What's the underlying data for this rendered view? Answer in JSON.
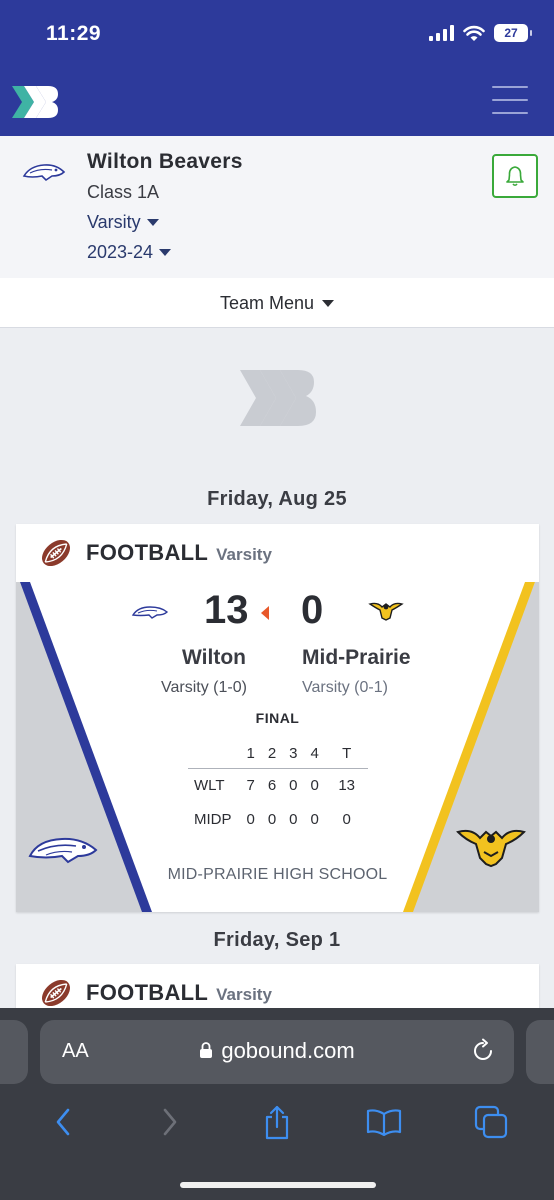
{
  "status_bar": {
    "time": "11:29",
    "battery": "27"
  },
  "team": {
    "name": "Wilton Beavers",
    "class": "Class 1A",
    "level": "Varsity",
    "season": "2023-24",
    "menu_label": "Team Menu"
  },
  "games": [
    {
      "date": "Friday, Aug 25",
      "sport": "FOOTBALL",
      "level": "Varsity",
      "home": {
        "name": "Wilton",
        "record": "Varsity (1-0)",
        "score": "13",
        "abbr": "WLT",
        "color": "#2d3a9b"
      },
      "away": {
        "name": "Mid-Prairie",
        "record": "Varsity (0-1)",
        "score": "0",
        "abbr": "MIDP",
        "color": "#f2c21f"
      },
      "status": "FINAL",
      "line_headers": [
        "1",
        "2",
        "3",
        "4",
        "T"
      ],
      "home_line": [
        "7",
        "6",
        "0",
        "0",
        "13"
      ],
      "away_line": [
        "0",
        "0",
        "0",
        "0",
        "0"
      ],
      "venue": "MID-PRAIRIE HIGH SCHOOL"
    },
    {
      "date": "Friday, Sep 1",
      "sport": "FOOTBALL",
      "level": "Varsity"
    }
  ],
  "browser": {
    "text_size_label": "AA",
    "url": "gobound.com"
  },
  "colors": {
    "header": "#2d3a9b",
    "accent_green": "#3aa93a",
    "winner_arrow": "#e8582a",
    "away_yellow": "#f2c21f"
  }
}
